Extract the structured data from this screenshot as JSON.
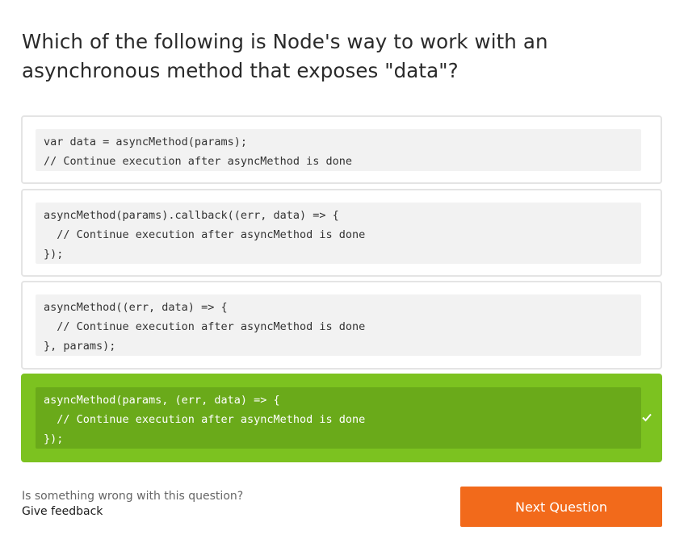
{
  "question": {
    "text": "Which of the following is Node's way to work with an asynchronous method that exposes \"data\"?"
  },
  "options": [
    {
      "code": "var data = asyncMethod(params);\n// Continue execution after asyncMethod is done",
      "correct": false
    },
    {
      "code": "asyncMethod(params).callback((err, data) => {\n  // Continue execution after asyncMethod is done\n});",
      "correct": false
    },
    {
      "code": "asyncMethod((err, data) => {\n  // Continue execution after asyncMethod is done\n}, params);",
      "correct": false
    },
    {
      "code": "asyncMethod(params, (err, data) => {\n  // Continue execution after asyncMethod is done\n});",
      "correct": true
    }
  ],
  "correct_icon": "check-icon",
  "footer": {
    "feedback_prompt": "Is something wrong with this question?",
    "feedback_link": "Give feedback",
    "next_button": "Next Question"
  },
  "colors": {
    "correct": "#7cc220",
    "correct_code_bg": "#6aaa1a",
    "next_button": "#f26a1b",
    "code_bg": "#f2f2f2",
    "border": "#e4e4e4"
  }
}
